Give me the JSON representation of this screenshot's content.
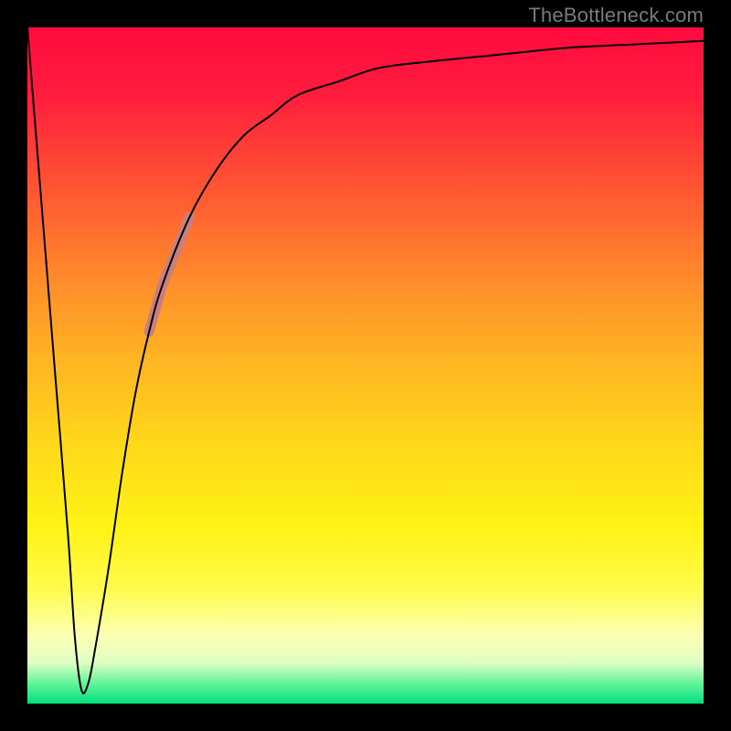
{
  "source_label": "TheBottleneck.com",
  "colors": {
    "frame": "#000000",
    "curve": "#000000",
    "highlight": "#c87f7d",
    "gradient_top": "#ff0a3f",
    "gradient_bottom": "#00e07e",
    "label": "#7a7a7a"
  },
  "chart_data": {
    "type": "line",
    "title": "",
    "xlabel": "",
    "ylabel": "",
    "xlim": [
      0,
      100
    ],
    "ylim": [
      0,
      100
    ],
    "grid": false,
    "legend": false,
    "series": [
      {
        "name": "bottleneck-curve",
        "x": [
          0,
          2,
          4,
          6,
          7,
          8,
          9,
          10,
          12,
          14,
          16,
          18,
          20,
          24,
          28,
          32,
          36,
          40,
          46,
          52,
          60,
          70,
          80,
          90,
          100
        ],
        "y": [
          100,
          75,
          50,
          25,
          10,
          2,
          3,
          8,
          20,
          34,
          46,
          55,
          62,
          72,
          79,
          84,
          87,
          90,
          92,
          94,
          95,
          96,
          97,
          97.5,
          98
        ]
      }
    ],
    "highlight_segment": {
      "series": "bottleneck-curve",
      "x_start": 18,
      "x_end": 24,
      "stroke_width": 11
    }
  }
}
